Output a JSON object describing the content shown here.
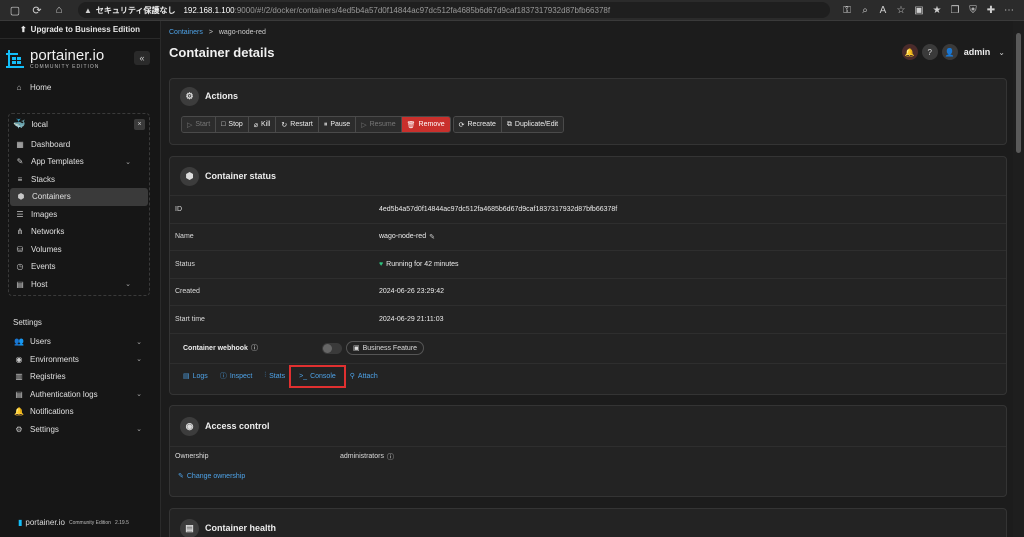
{
  "browser": {
    "url_warning": "セキュリティ保護なし",
    "url_host": "192.168.1.100",
    "url_rest": ":9000/#!/2/docker/containers/4ed5b4a57d0f14844ac97dc512fa4685b6d67d9caf1837317932d87bfb66378f"
  },
  "sidebar": {
    "upgrade": "Upgrade to Business Edition",
    "logo": "portainer.io",
    "logo_sub": "COMMUNITY EDITION",
    "home": "Home",
    "env_name": "local",
    "env_items": [
      "Dashboard",
      "App Templates",
      "Stacks",
      "Containers",
      "Images",
      "Networks",
      "Volumes",
      "Events",
      "Host"
    ],
    "settings_label": "Settings",
    "settings_items": [
      "Users",
      "Environments",
      "Registries",
      "Authentication logs",
      "Notifications",
      "Settings"
    ],
    "footer_name": "portainer.io",
    "footer_edition": "Community Edition",
    "footer_version": "2.19.5"
  },
  "header": {
    "crumb_link": "Containers",
    "crumb_sep": ">",
    "crumb_current": "wago-node-red",
    "title": "Container details",
    "user": "admin"
  },
  "actions": {
    "title": "Actions",
    "buttons": [
      "Start",
      "Stop",
      "Kill",
      "Restart",
      "Pause",
      "Resume",
      "Remove",
      "Recreate",
      "Duplicate/Edit"
    ]
  },
  "status": {
    "title": "Container status",
    "id_label": "ID",
    "id_value": "4ed5b4a57d0f14844ac97dc512fa4685b6d67d9caf1837317932d87bfb66378f",
    "name_label": "Name",
    "name_value": "wago-node-red",
    "status_label": "Status",
    "status_value": "Running for 42 minutes",
    "created_label": "Created",
    "created_value": "2024-06-26 23:29:42",
    "start_label": "Start time",
    "start_value": "2024-06-29 21:11:03",
    "webhook_label": "Container webhook",
    "business_feature": "Business Feature",
    "links": [
      "Logs",
      "Inspect",
      "Stats",
      "Console",
      "Attach"
    ]
  },
  "access": {
    "title": "Access control",
    "ownership_label": "Ownership",
    "ownership_value": "administrators",
    "change": "Change ownership"
  },
  "health": {
    "title": "Container health"
  }
}
